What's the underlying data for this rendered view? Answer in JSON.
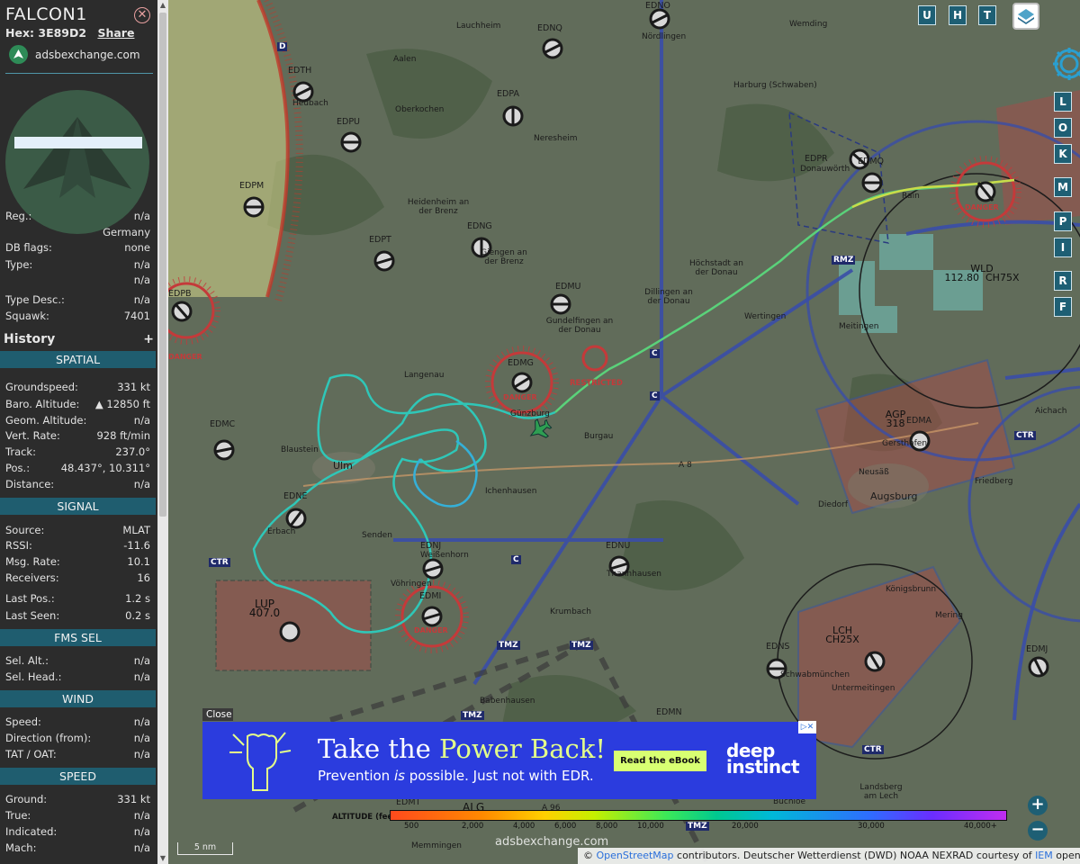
{
  "aircraft": {
    "callsign": "FALCON1",
    "hex_label": "Hex:",
    "hex_value": "3E89D2",
    "share_label": "Share",
    "site": "adsbexchange.com"
  },
  "info_rows": [
    {
      "label": "Reg.:",
      "value": "n/a"
    },
    {
      "label": "",
      "value": "Germany"
    },
    {
      "label": "DB flags:",
      "value": "none"
    },
    {
      "label": "Type:",
      "value": "n/a"
    },
    {
      "label": "",
      "value": "n/a"
    },
    {
      "label": "Type Desc.:",
      "value": "n/a"
    },
    {
      "label": "Squawk:",
      "value": "7401"
    }
  ],
  "history": {
    "label": "History",
    "add": "+"
  },
  "sections": {
    "spatial": {
      "title": "SPATIAL",
      "rows": [
        {
          "label": "Groundspeed:",
          "value": "331 kt"
        },
        {
          "label": "Baro. Altitude:",
          "value": "▲ 12850 ft"
        },
        {
          "label": "Geom. Altitude:",
          "value": "n/a"
        },
        {
          "label": "Vert. Rate:",
          "value": "928 ft/min"
        },
        {
          "label": "Track:",
          "value": "237.0°"
        },
        {
          "label": "Pos.:",
          "value": "48.437°, 10.311°"
        },
        {
          "label": "Distance:",
          "value": "n/a"
        }
      ]
    },
    "signal": {
      "title": "SIGNAL",
      "rows": [
        {
          "label": "Source:",
          "value": "MLAT"
        },
        {
          "label": "RSSI:",
          "value": "-11.6"
        },
        {
          "label": "Msg. Rate:",
          "value": "10.1"
        },
        {
          "label": "Receivers:",
          "value": "16"
        },
        {
          "label": "Last Pos.:",
          "value": "1.2 s"
        },
        {
          "label": "Last Seen:",
          "value": "0.2 s"
        }
      ]
    },
    "fms": {
      "title": "FMS SEL",
      "rows": [
        {
          "label": "Sel. Alt.:",
          "value": "n/a"
        },
        {
          "label": "Sel. Head.:",
          "value": "n/a"
        }
      ]
    },
    "wind": {
      "title": "WIND",
      "rows": [
        {
          "label": "Speed:",
          "value": "n/a"
        },
        {
          "label": "Direction (from):",
          "value": "n/a"
        },
        {
          "label": "TAT / OAT:",
          "value": "n/a"
        }
      ]
    },
    "speed": {
      "title": "SPEED",
      "rows": [
        {
          "label": "Ground:",
          "value": "331 kt"
        },
        {
          "label": "True:",
          "value": "n/a"
        },
        {
          "label": "Indicated:",
          "value": "n/a"
        },
        {
          "label": "Mach:",
          "value": "n/a"
        }
      ]
    }
  },
  "map": {
    "top_buttons": [
      "U",
      "H",
      "T"
    ],
    "side_buttons": [
      "L",
      "O",
      "K",
      "M",
      "P",
      "I",
      "R",
      "F"
    ],
    "zoom_in": "+",
    "zoom_out": "−",
    "scale_label": "5 nm",
    "watermark": "adsbexchange.com",
    "attribution": {
      "prefix": "©",
      "osm": "OpenStreetMap",
      "mid": "contributors. Deutscher Wetterdienst (DWD) NOAA NEXRAD courtesy of",
      "iem": "IEM",
      "suffix": "openAIP.net"
    },
    "altitude_scale": {
      "label": "ALTITUDE (feet)",
      "ticks": [
        "500",
        "2,000",
        "4,000",
        "6,000",
        "8,000",
        "10,000",
        "20,000",
        "30,000",
        "40,000+"
      ]
    },
    "airports": [
      "EDNO",
      "EDNQ",
      "EDTH",
      "EDPA",
      "EDPU",
      "EDPM",
      "EDNG",
      "EDPT",
      "EDPB",
      "EDMU",
      "EDMG",
      "EDMC",
      "EDNE",
      "EDNJ",
      "EDNU",
      "EDMI",
      "EDPR",
      "EDMQ",
      "EDMA",
      "EDNS",
      "EDMJ",
      "EDMN",
      "EDMT"
    ],
    "zones": [
      {
        "label": "DANGER"
      },
      {
        "label": "RESTRICTED"
      },
      {
        "label": "LUP\n407.0"
      },
      {
        "label": "AGP\n318"
      },
      {
        "label": "WLD\n112.80  CH75X"
      },
      {
        "label": "LCH\nCH25X"
      },
      {
        "label": "ALG"
      }
    ],
    "towns": [
      "Lauchheim",
      "Nördlingen",
      "Aalen",
      "Wemding",
      "Heubach",
      "Oberkochen",
      "Harburg (Schwaben)",
      "Neresheim",
      "Donauwörth",
      "Rain",
      "Heidenheim an der Brenz",
      "Giengen an der Brenz",
      "Höchstadt an der Donau",
      "Dillingen an der Donau",
      "Wertingen",
      "Meitingen",
      "Gundelfingen an der Donau",
      "Langenau",
      "Günzburg",
      "Burgau",
      "Gersthofen",
      "Augsburg",
      "Friedberg",
      "Neusäß",
      "Aichach",
      "Ulm",
      "Blaustein",
      "Ichenhausen",
      "Senden",
      "Erbach",
      "Vöhringen",
      "Weißenhorn",
      "Thannhausen",
      "Krumbach",
      "Diedorf",
      "Königsbrunn",
      "Mering",
      "Schwabmünchen",
      "Untermeitingen",
      "Babenhausen",
      "Buchloe",
      "Landsberg am Lech",
      "Memmingen"
    ],
    "labels_ctr": [
      "CTR",
      "CTR",
      "CTR",
      "CTR"
    ],
    "labels_tmz": [
      "TMZ",
      "TMZ",
      "TMZ",
      "TMZ"
    ],
    "labels_rmz": [
      "RMZ"
    ],
    "motorways": [
      "A 8",
      "A 96"
    ],
    "letter_markers": [
      "D",
      "C",
      "H"
    ]
  },
  "ad": {
    "close_label": "Close",
    "headline_a": "Take the ",
    "headline_b": "Power Back!",
    "sub_a": "Prevention ",
    "sub_i": "is",
    "sub_b": " possible. Just not with EDR.",
    "button": "Read the eBook",
    "brand_1": "deep",
    "brand_2": "instinct",
    "adchoice": "▷✕"
  },
  "colors": {
    "sidebar_bg": "#2c2c2c",
    "section_bg": "#1f5d6f",
    "ad_bg": "#2b3cde",
    "ad_accent": "#d8ff72",
    "danger": "#c43a3a",
    "airspace_blue": "#3a4ea8",
    "track_start": "#2fc7a8",
    "track_end": "#e6e04a"
  }
}
